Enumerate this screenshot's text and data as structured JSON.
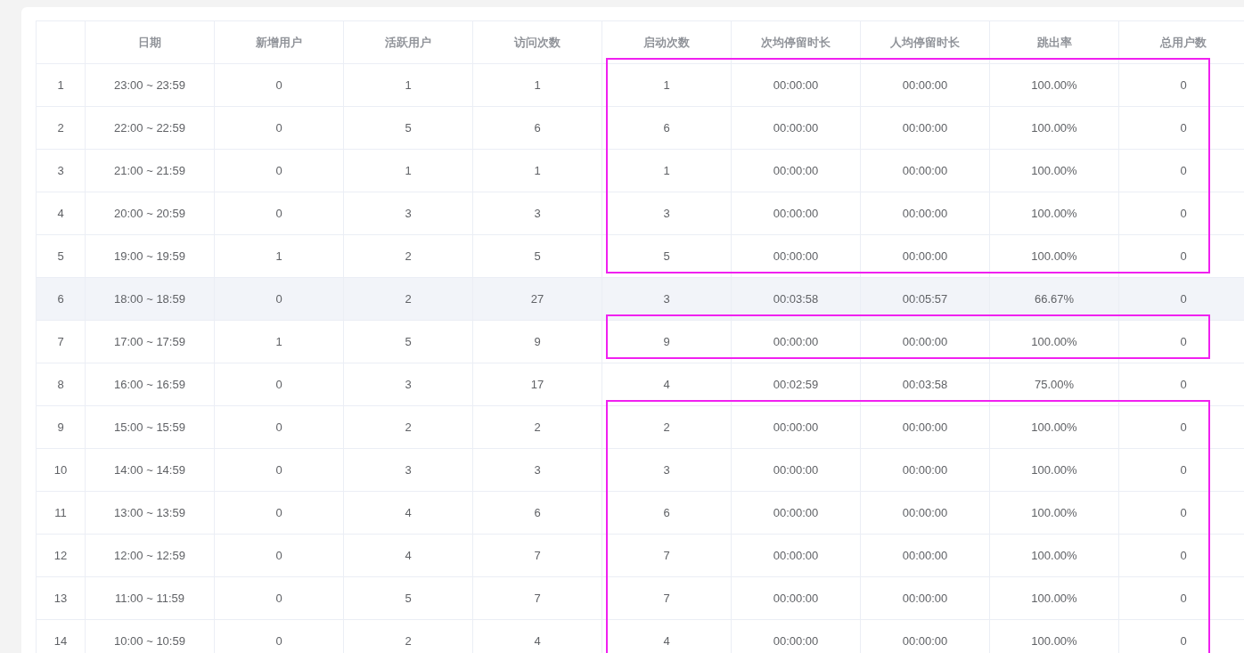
{
  "table": {
    "columns": [
      "",
      "日期",
      "新增用户",
      "活跃用户",
      "访问次数",
      "启动次数",
      "次均停留时长",
      "人均停留时长",
      "跳出率",
      "总用户数"
    ],
    "rows": [
      {
        "cells": [
          "1",
          "23:00 ~ 23:59",
          "0",
          "1",
          "1",
          "1",
          "00:00:00",
          "00:00:00",
          "100.00%",
          "0"
        ],
        "selected": false,
        "marked": true
      },
      {
        "cells": [
          "2",
          "22:00 ~ 22:59",
          "0",
          "5",
          "6",
          "6",
          "00:00:00",
          "00:00:00",
          "100.00%",
          "0"
        ],
        "selected": false,
        "marked": true
      },
      {
        "cells": [
          "3",
          "21:00 ~ 21:59",
          "0",
          "1",
          "1",
          "1",
          "00:00:00",
          "00:00:00",
          "100.00%",
          "0"
        ],
        "selected": false,
        "marked": true
      },
      {
        "cells": [
          "4",
          "20:00 ~ 20:59",
          "0",
          "3",
          "3",
          "3",
          "00:00:00",
          "00:00:00",
          "100.00%",
          "0"
        ],
        "selected": false,
        "marked": true
      },
      {
        "cells": [
          "5",
          "19:00 ~ 19:59",
          "1",
          "2",
          "5",
          "5",
          "00:00:00",
          "00:00:00",
          "100.00%",
          "0"
        ],
        "selected": false,
        "marked": true
      },
      {
        "cells": [
          "6",
          "18:00 ~ 18:59",
          "0",
          "2",
          "27",
          "3",
          "00:03:58",
          "00:05:57",
          "66.67%",
          "0"
        ],
        "selected": true,
        "marked": false
      },
      {
        "cells": [
          "7",
          "17:00 ~ 17:59",
          "1",
          "5",
          "9",
          "9",
          "00:00:00",
          "00:00:00",
          "100.00%",
          "0"
        ],
        "selected": false,
        "marked": true
      },
      {
        "cells": [
          "8",
          "16:00 ~ 16:59",
          "0",
          "3",
          "17",
          "4",
          "00:02:59",
          "00:03:58",
          "75.00%",
          "0"
        ],
        "selected": false,
        "marked": false
      },
      {
        "cells": [
          "9",
          "15:00 ~ 15:59",
          "0",
          "2",
          "2",
          "2",
          "00:00:00",
          "00:00:00",
          "100.00%",
          "0"
        ],
        "selected": false,
        "marked": true
      },
      {
        "cells": [
          "10",
          "14:00 ~ 14:59",
          "0",
          "3",
          "3",
          "3",
          "00:00:00",
          "00:00:00",
          "100.00%",
          "0"
        ],
        "selected": false,
        "marked": true
      },
      {
        "cells": [
          "11",
          "13:00 ~ 13:59",
          "0",
          "4",
          "6",
          "6",
          "00:00:00",
          "00:00:00",
          "100.00%",
          "0"
        ],
        "selected": false,
        "marked": true
      },
      {
        "cells": [
          "12",
          "12:00 ~ 12:59",
          "0",
          "4",
          "7",
          "7",
          "00:00:00",
          "00:00:00",
          "100.00%",
          "0"
        ],
        "selected": false,
        "marked": true
      },
      {
        "cells": [
          "13",
          "11:00 ~ 11:59",
          "0",
          "5",
          "7",
          "7",
          "00:00:00",
          "00:00:00",
          "100.00%",
          "0"
        ],
        "selected": false,
        "marked": true
      },
      {
        "cells": [
          "14",
          "10:00 ~ 10:59",
          "0",
          "2",
          "4",
          "4",
          "00:00:00",
          "00:00:00",
          "100.00%",
          "0"
        ],
        "selected": false,
        "marked": true
      }
    ]
  }
}
